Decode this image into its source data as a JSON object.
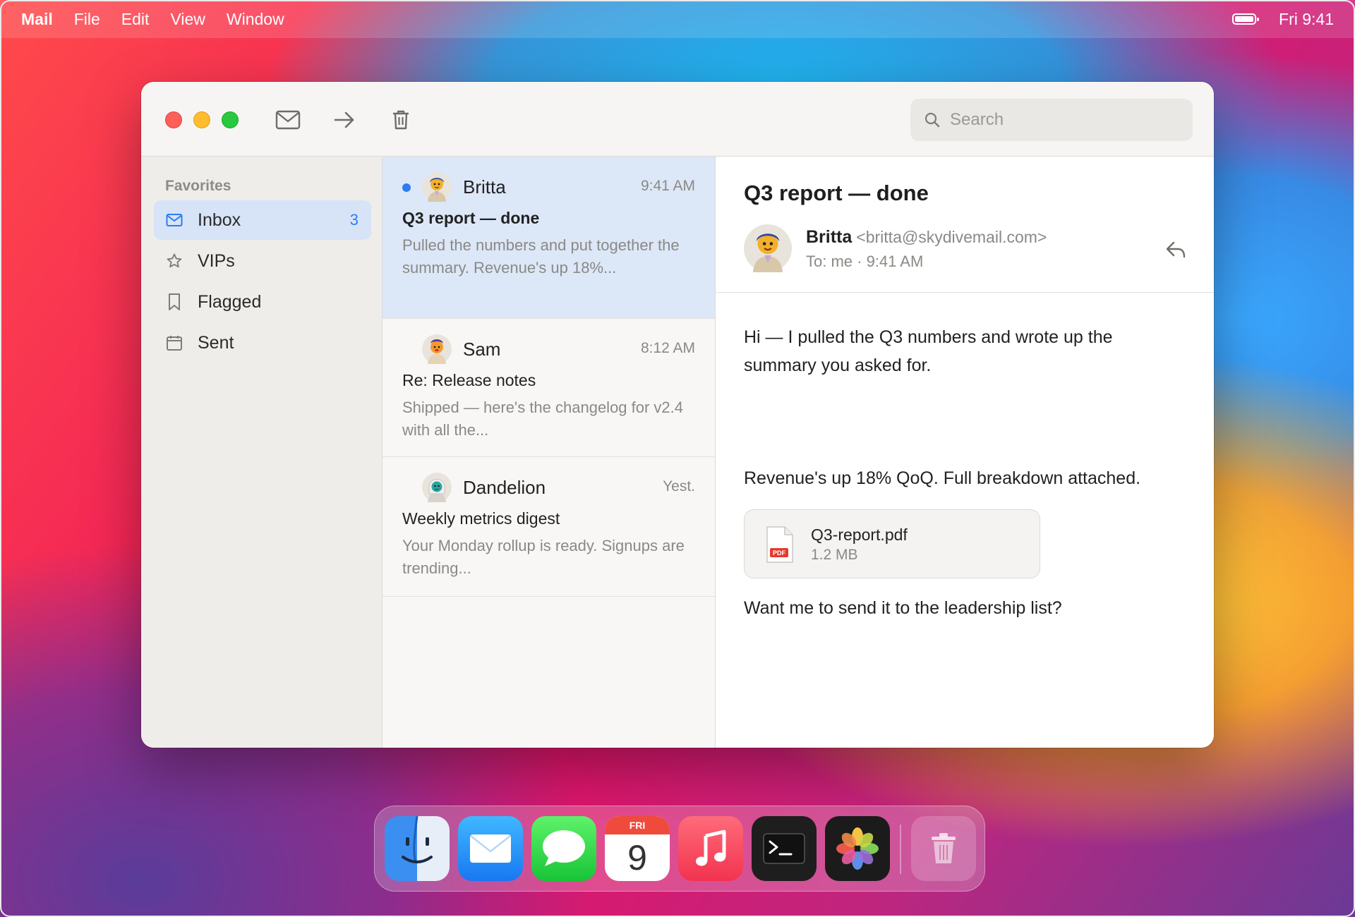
{
  "menubar": {
    "app": "Mail",
    "items": [
      "File",
      "Edit",
      "View",
      "Window"
    ],
    "clock": "Fri 9:41"
  },
  "toolbar": {
    "icons": [
      "envelope-icon",
      "arrow-right-icon",
      "trash-icon"
    ],
    "search_placeholder": "Search"
  },
  "sidebar": {
    "section_title": "Favorites",
    "items": [
      {
        "label": "Inbox",
        "count": "3",
        "icon": "envelope-icon"
      },
      {
        "label": "VIPs",
        "icon": "star-icon"
      },
      {
        "label": "Flagged",
        "icon": "bookmark-icon"
      },
      {
        "label": "Sent",
        "icon": "calendar-icon"
      }
    ]
  },
  "messages": [
    {
      "sender": "Britta",
      "time": "9:41 AM",
      "subject": "Q3 report — done",
      "preview": "Pulled the numbers and put together the summary. Revenue's up 18%...",
      "unread": true,
      "selected": true
    },
    {
      "sender": "Sam",
      "time": "8:12 AM",
      "subject": "Re: Release notes",
      "preview": "Shipped — here's the changelog for v2.4 with all the..."
    },
    {
      "sender": "Dandelion",
      "time": "Yest.",
      "subject": "Weekly metrics digest",
      "preview": "Your Monday rollup is ready. Signups are trending..."
    }
  ],
  "reader": {
    "subject": "Q3 report — done",
    "from_name": "Britta",
    "from_email": "<britta@skydivemail.com>",
    "meta": "To: me · 9:41 AM",
    "body": [
      "Hi — I pulled the Q3 numbers and wrote up the summary you asked for.",
      "Revenue's up 18% QoQ. Full breakdown attached.",
      "Want me to send it to the leadership list?"
    ],
    "attachment": {
      "name": "Q3-report.pdf",
      "size": "1.2 MB",
      "badge": "PDF"
    }
  },
  "dock": {
    "apps": [
      "Finder",
      "Mail",
      "Messages",
      "Calendar",
      "Music",
      "Terminal",
      "Photos",
      "Trash"
    ],
    "calendar_day": "FRI",
    "calendar_date": "9"
  },
  "colors": {
    "accent": "#2d7df1",
    "selection": "#dce7f8",
    "sidebar_active": "#d7e3f7"
  }
}
